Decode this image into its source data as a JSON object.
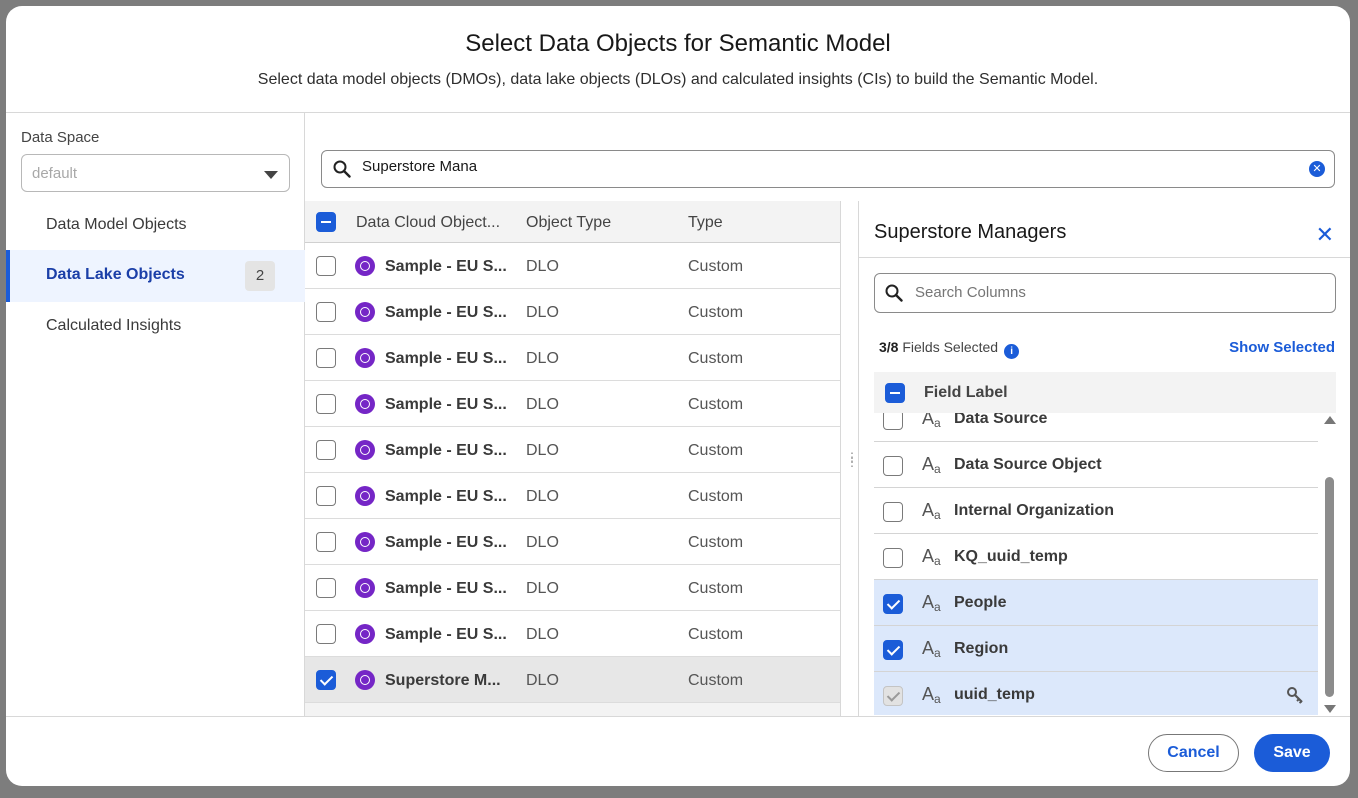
{
  "modal": {
    "title": "Select Data Objects for Semantic Model",
    "subtitle": "Select data model objects (DMOs), data lake objects (DLOs) and calculated insights (CIs) to build the Semantic Model."
  },
  "left_nav": {
    "data_space_label": "Data Space",
    "data_space_value": "default",
    "items": [
      {
        "label": "Data Model Objects",
        "active": false
      },
      {
        "label": "Data Lake Objects",
        "active": true,
        "count": "2"
      },
      {
        "label": "Calculated Insights",
        "active": false
      }
    ]
  },
  "search": {
    "value": "Superstore Mana"
  },
  "table": {
    "columns": [
      "Data Cloud Object...",
      "Object Type",
      "Type"
    ],
    "rows": [
      {
        "name": "Sample - EU S...",
        "object_type": "DLO",
        "type": "Custom",
        "checked": false
      },
      {
        "name": "Sample - EU S...",
        "object_type": "DLO",
        "type": "Custom",
        "checked": false
      },
      {
        "name": "Sample - EU S...",
        "object_type": "DLO",
        "type": "Custom",
        "checked": false
      },
      {
        "name": "Sample - EU S...",
        "object_type": "DLO",
        "type": "Custom",
        "checked": false
      },
      {
        "name": "Sample - EU S...",
        "object_type": "DLO",
        "type": "Custom",
        "checked": false
      },
      {
        "name": "Sample - EU S...",
        "object_type": "DLO",
        "type": "Custom",
        "checked": false
      },
      {
        "name": "Sample - EU S...",
        "object_type": "DLO",
        "type": "Custom",
        "checked": false
      },
      {
        "name": "Sample - EU S...",
        "object_type": "DLO",
        "type": "Custom",
        "checked": false
      },
      {
        "name": "Sample - EU S...",
        "object_type": "DLO",
        "type": "Custom",
        "checked": false
      },
      {
        "name": "Superstore M...",
        "object_type": "DLO",
        "type": "Custom",
        "checked": true
      }
    ]
  },
  "panel": {
    "title": "Superstore Managers",
    "search_placeholder": "Search Columns",
    "fields_selected_count": "3/8",
    "fields_selected_text": " Fields Selected",
    "show_selected": "Show Selected",
    "field_label_header": "Field Label",
    "fields": [
      {
        "label": "Data Source",
        "checked": false
      },
      {
        "label": "Data Source Object",
        "checked": false
      },
      {
        "label": "Internal Organization",
        "checked": false
      },
      {
        "label": "KQ_uuid_temp",
        "checked": false
      },
      {
        "label": "People",
        "checked": true
      },
      {
        "label": "Region",
        "checked": true
      },
      {
        "label": "uuid_temp",
        "checked": true,
        "locked": true,
        "key": true
      }
    ]
  },
  "footer": {
    "cancel": "Cancel",
    "save": "Save"
  },
  "colors": {
    "accent": "#1b5cd8",
    "object_icon": "#7526c6",
    "selected_row": "#dce8fb"
  }
}
